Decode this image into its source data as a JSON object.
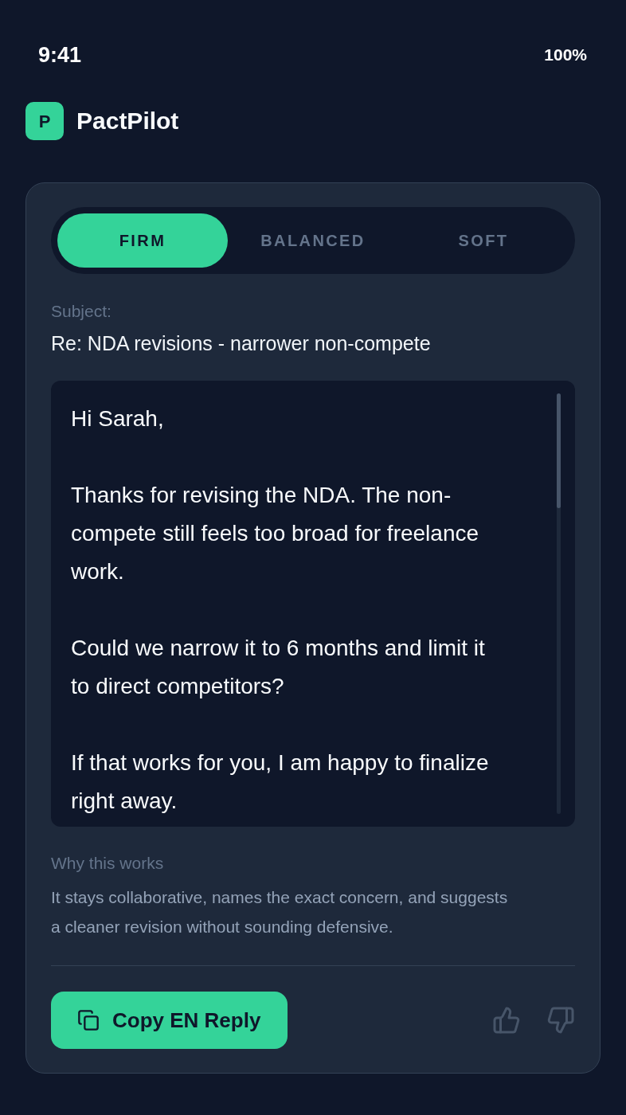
{
  "status_bar": {
    "time": "9:41",
    "battery": "100%"
  },
  "app": {
    "logo_letter": "P",
    "name": "PactPilot"
  },
  "tone_tabs": [
    {
      "label": "FIRM",
      "selected": true
    },
    {
      "label": "BALANCED",
      "selected": false
    },
    {
      "label": "SOFT",
      "selected": false
    }
  ],
  "subject": {
    "label": "Subject:",
    "value": "Re: NDA revisions - narrower non-compete"
  },
  "reply_body": {
    "paragraphs": [
      "Hi Sarah,",
      "Thanks for revising the NDA. The non-compete still feels too broad for freelance work.",
      "Could we narrow it to 6 months and limit it to direct competitors?",
      "If that works for you, I am happy to finalize right away."
    ]
  },
  "explanation": {
    "title": "Why this works",
    "text": "It stays collaborative, names the exact concern, and suggests a cleaner revision without sounding defensive."
  },
  "actions": {
    "copy_button": "Copy EN Reply"
  }
}
